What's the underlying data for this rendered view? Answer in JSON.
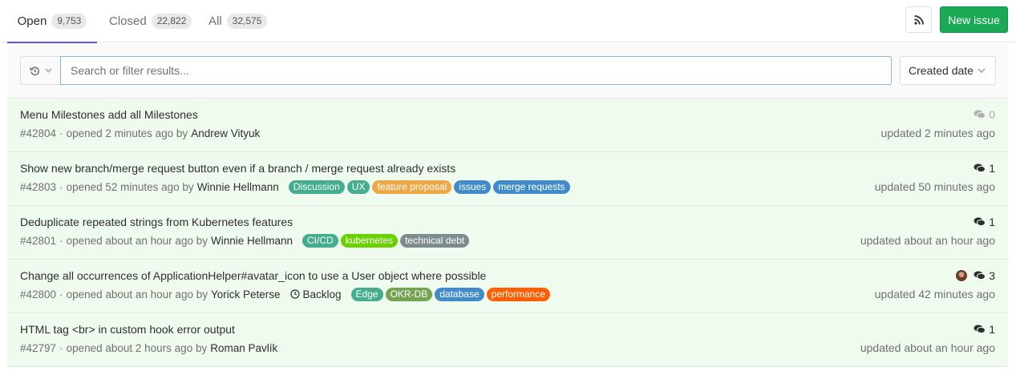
{
  "tabs": [
    {
      "label": "Open",
      "count": "9,753"
    },
    {
      "label": "Closed",
      "count": "22,822"
    },
    {
      "label": "All",
      "count": "32,575"
    }
  ],
  "actions": {
    "new_issue": "New issue",
    "rss_icon": "rss-icon"
  },
  "filter": {
    "placeholder": "Search or filter results...",
    "sort_label": "Created date"
  },
  "issues": [
    {
      "title": "Menu Milestones add all Milestones",
      "ref": "#42804",
      "opened": "opened 2 minutes ago by",
      "author": "Andrew Vityuk",
      "comments": "0",
      "updated": "updated 2 minutes ago",
      "labels": []
    },
    {
      "title": "Show new branch/merge request button even if a branch / merge request already exists",
      "ref": "#42803",
      "opened": "opened 52 minutes ago by",
      "author": "Winnie Hellmann",
      "comments": "1",
      "updated": "updated 50 minutes ago",
      "labels": [
        {
          "text": "Discussion",
          "color": "#44ad8e"
        },
        {
          "text": "UX",
          "color": "#44ad8e"
        },
        {
          "text": "feature proposal",
          "color": "#eea946"
        },
        {
          "text": "issues",
          "color": "#428bca"
        },
        {
          "text": "merge requests",
          "color": "#428bca"
        }
      ]
    },
    {
      "title": "Deduplicate repeated strings from Kubernetes features",
      "ref": "#42801",
      "opened": "opened about an hour ago by",
      "author": "Winnie Hellmann",
      "comments": "1",
      "updated": "updated about an hour ago",
      "labels": [
        {
          "text": "CI/CD",
          "color": "#44ad8e"
        },
        {
          "text": "kubernetes",
          "color": "#69d100"
        },
        {
          "text": "technical debt",
          "color": "#7f8c8d"
        }
      ]
    },
    {
      "title": "Change all occurrences of ApplicationHelper#avatar_icon to use a User object where possible",
      "ref": "#42800",
      "opened": "opened about an hour ago by",
      "author": "Yorick Peterse",
      "milestone": "Backlog",
      "comments": "3",
      "updated": "updated 42 minutes ago",
      "labels": [
        {
          "text": "Edge",
          "color": "#44ad8e"
        },
        {
          "text": "OKR-DB",
          "color": "#74a352"
        },
        {
          "text": "database",
          "color": "#428bca"
        },
        {
          "text": "performance",
          "color": "#ff5f00"
        }
      ]
    },
    {
      "title": "HTML tag <br> in custom hook error output",
      "ref": "#42797",
      "opened": "opened about 2 hours ago by",
      "author": "Roman Pavlík",
      "comments": "1",
      "updated": "updated about an hour ago",
      "labels": []
    }
  ]
}
